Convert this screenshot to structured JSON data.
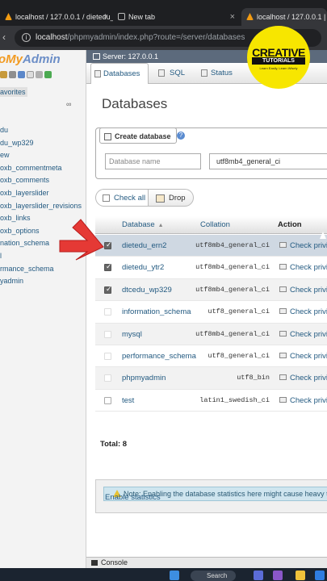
{
  "browser": {
    "tabs": [
      {
        "title": "localhost / 127.0.0.1 / dietedu_yt",
        "active": false
      },
      {
        "title": "New tab",
        "active": false
      },
      {
        "title": "localhost / 127.0.0.1 | ph",
        "active": true
      }
    ],
    "url_host": "localhost",
    "url_path": "/phpmyadmin/index.php?route=/server/databases"
  },
  "sidebar": {
    "logo_php": "oMy",
    "logo_admin": "Admin",
    "favorites": "avorites",
    "collapse": "∞",
    "tree": [
      "du",
      "du_wp329",
      "ew",
      "oxb_commentmeta",
      "oxb_comments",
      "oxb_layerslider",
      "oxb_layerslider_revisions",
      "oxb_links",
      "oxb_options",
      "nation_schema",
      "l",
      "rmance_schema",
      "yadmin"
    ]
  },
  "server": {
    "label": "Server: 127.0.0.1"
  },
  "top_menu": {
    "databases": "Databases",
    "sql": "SQL",
    "status": "Status"
  },
  "page": {
    "title": "Databases",
    "create_label": "Create database",
    "dbname_placeholder": "Database name",
    "collation_value": "utf8mb4_general_ci",
    "check_all": "Check all",
    "drop": "Drop"
  },
  "table": {
    "headers": {
      "database": "Database",
      "collation": "Collation",
      "action": "Action"
    },
    "rows": [
      {
        "name": "dietedu_ern2",
        "collation": "utf8mb4_general_ci",
        "action": "Check privil",
        "checked": true
      },
      {
        "name": "dietedu_ytr2",
        "collation": "utf8mb4_general_ci",
        "action": "Check privil",
        "checked": true
      },
      {
        "name": "dtcedu_wp329",
        "collation": "utf8mb4_general_ci",
        "action": "Check privil",
        "checked": true
      },
      {
        "name": "information_schema",
        "collation": "utf8_general_ci",
        "action": "Check privil",
        "checked": false
      },
      {
        "name": "mysql",
        "collation": "utf8mb4_general_ci",
        "action": "Check privil",
        "checked": false
      },
      {
        "name": "performance_schema",
        "collation": "utf8_general_ci",
        "action": "Check privil",
        "checked": false
      },
      {
        "name": "phpmyadmin",
        "collation": "utf8_bin",
        "action": "Check privil",
        "checked": false
      },
      {
        "name": "test",
        "collation": "latin1_swedish_ci",
        "action": "Check privil",
        "checked": false
      }
    ],
    "total": "Total: 8"
  },
  "notice": {
    "text": "Note: Enabling the database statistics here might cause heavy tra",
    "enable_link": "Enable statistics"
  },
  "console": {
    "label": "Console"
  },
  "taskbar": {
    "search": "Search"
  },
  "watermark": {
    "line1": "CREATIVE",
    "line2": "TUTORIALS",
    "line3": "Learn Easily, Learn Wisely"
  },
  "colors": {
    "link": "#235a81",
    "accent_logo": "#f29b22",
    "badge": "#f7e600",
    "arrow": "#e53935"
  }
}
